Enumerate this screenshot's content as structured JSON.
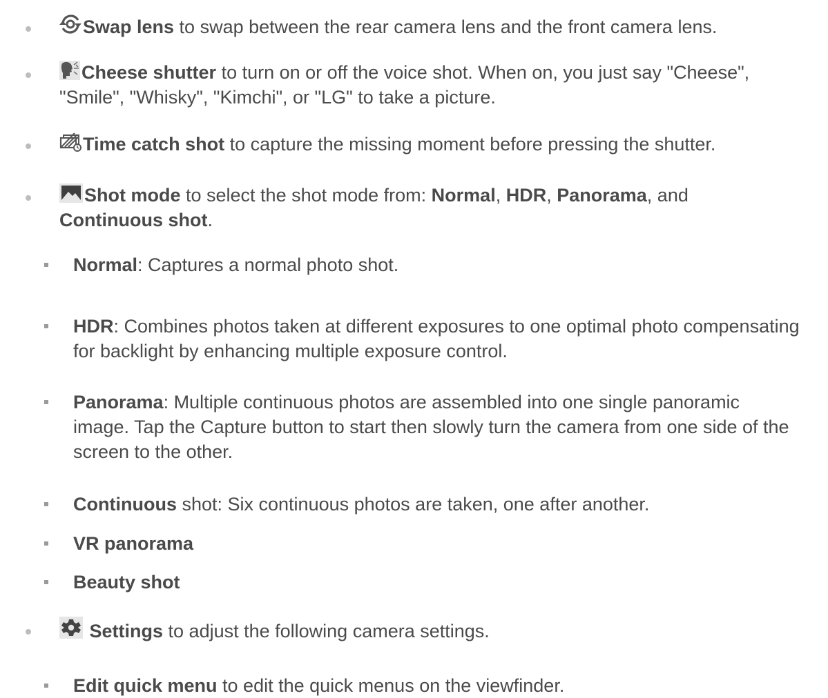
{
  "items": [
    {
      "icon": "swap-lens-icon",
      "title": "Swap lens",
      "text": " to swap between the rear camera lens and the front camera lens."
    },
    {
      "icon": "cheese-shutter-icon",
      "title": "Cheese shutter",
      "text": " to turn on or off the voice shot. When on, you just say \"Cheese\", \"Smile\", \"Whisky\", \"Kimchi\", or \"LG\" to take a picture."
    },
    {
      "icon": "time-catch-shot-icon",
      "title": "Time catch shot",
      "text": " to capture the missing moment before pressing the shutter."
    },
    {
      "icon": "shot-mode-icon",
      "title": "Shot mode",
      "text_a": " to select the shot mode from: ",
      "opt1": "Normal",
      "sep1": ", ",
      "opt2": "HDR",
      "sep2": ", ",
      "opt3": "Panorama",
      "sep3": ", and",
      "opt4": "Continuous shot",
      "end": ".",
      "sub": [
        {
          "title": "Normal",
          "text": ": Captures a normal photo shot."
        },
        {
          "title": "HDR",
          "text": ": Combines photos taken at different exposures to one optimal photo compensating for backlight by enhancing multiple exposure control."
        },
        {
          "title": "Panorama",
          "text": ": Multiple continuous photos are assembled into one single panoramic image. Tap the Capture button to start then slowly turn the camera from one side of the screen to the other."
        },
        {
          "title": "Continuous",
          "text": " shot: Six continuous photos are taken, one after another."
        },
        {
          "title": "VR panorama",
          "text": ""
        },
        {
          "title": "Beauty shot",
          "text": ""
        }
      ]
    },
    {
      "icon": "gear-icon",
      "title": "Settings",
      "text": " to adjust the following camera settings.",
      "sub": [
        {
          "title": "Edit quick menu",
          "text": " to edit the quick menus on the viewfinder."
        }
      ]
    }
  ]
}
